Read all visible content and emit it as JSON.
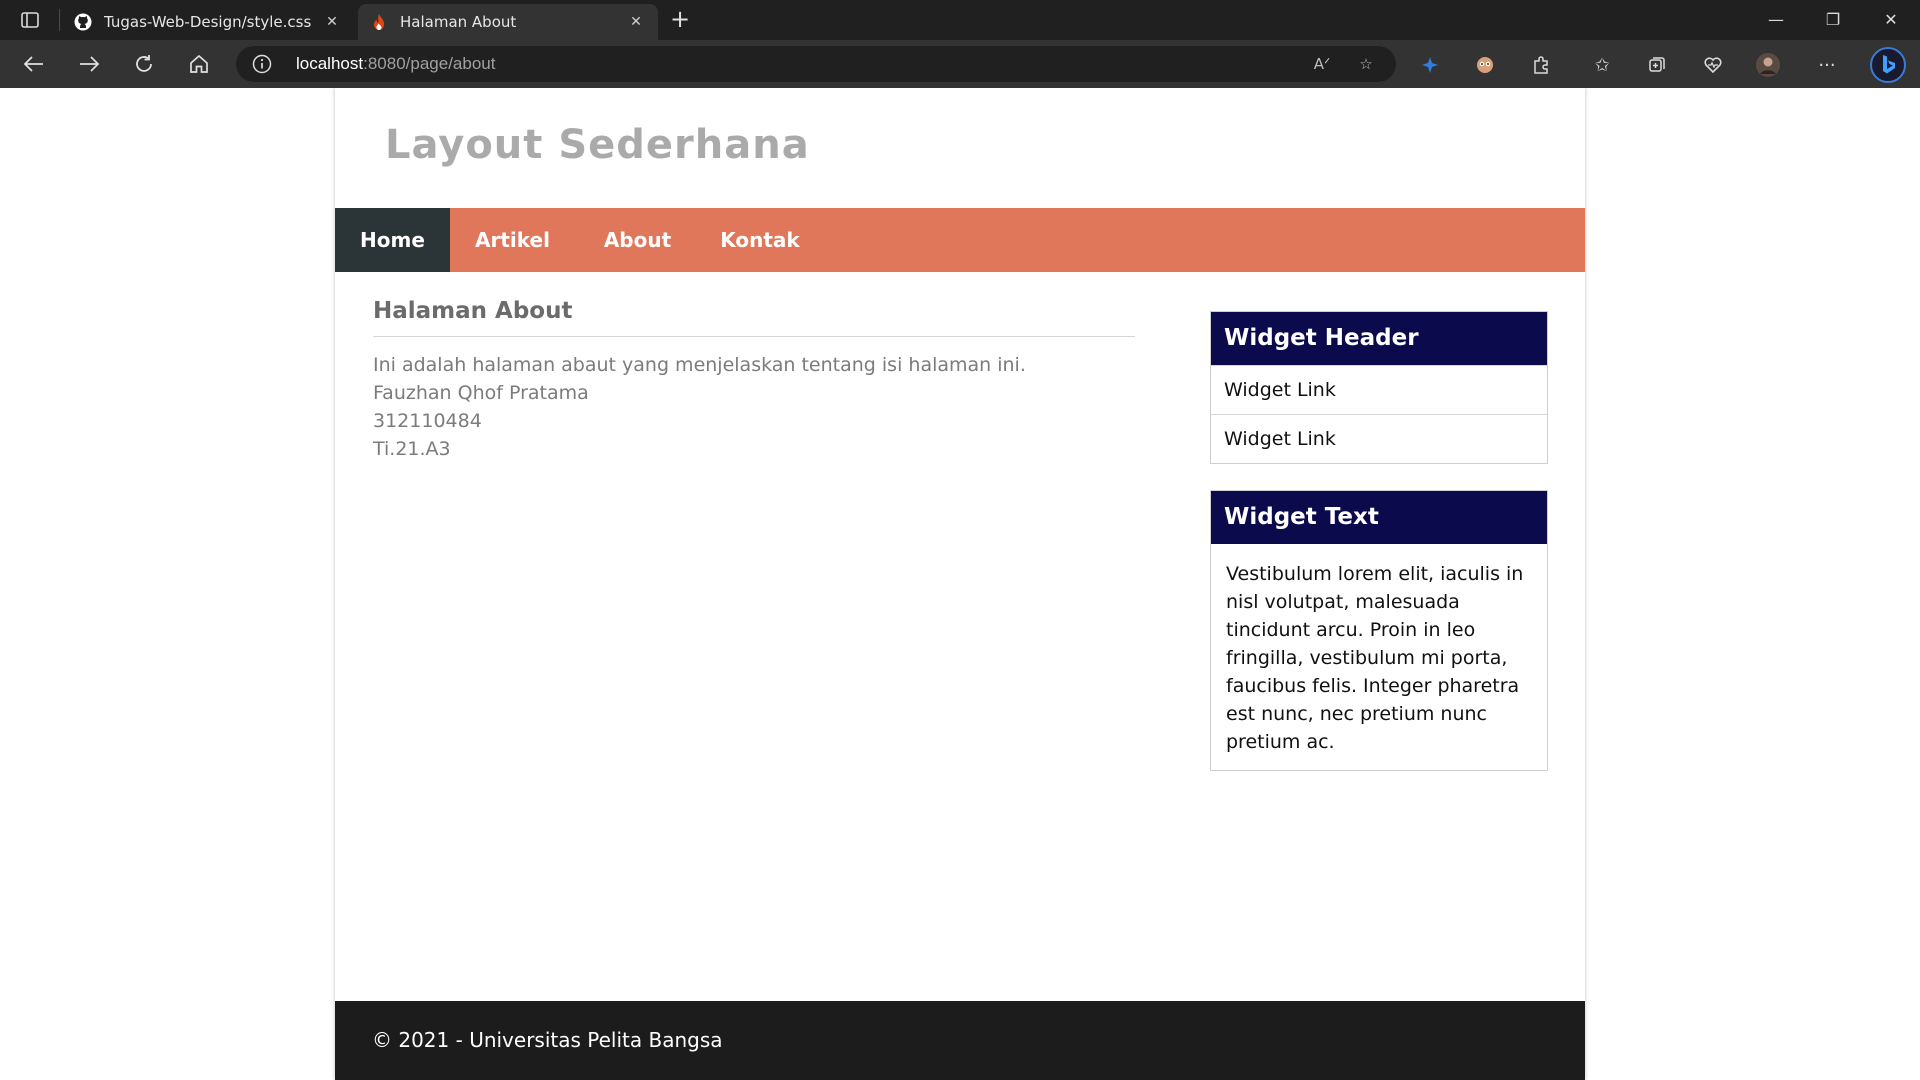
{
  "browser": {
    "tabs": [
      {
        "title": "Tugas-Web-Design/style.css at m",
        "icon": "github-icon",
        "active": false
      },
      {
        "title": "Halaman About",
        "icon": "codeigniter-icon",
        "active": true
      }
    ],
    "url_host": "localhost",
    "url_rest": ":8080/page/about"
  },
  "site": {
    "title": "Layout Sederhana",
    "nav": [
      "Home",
      "Artikel",
      "About",
      "Kontak"
    ],
    "active_nav": "Home",
    "colors": {
      "nav": "#e0775a",
      "nav_active": "#2b3537",
      "widget_header": "#0a0a4d",
      "footer": "#1c1c1c"
    }
  },
  "content": {
    "heading": "Halaman About",
    "lines": [
      "Ini adalah halaman abaut yang menjelaskan tentang isi halaman ini.",
      "Fauzhan Qhof Pratama",
      "312110484",
      "Ti.21.A3"
    ]
  },
  "sidebar": {
    "widget1": {
      "header": "Widget Header",
      "links": [
        "Widget Link",
        "Widget Link"
      ]
    },
    "widget2": {
      "header": "Widget Text",
      "text": "Vestibulum lorem elit, iaculis in nisl volutpat, malesuada tincidunt arcu. Proin in leo fringilla, vestibulum mi porta, faucibus felis. Integer pharetra est nunc, nec pretium nunc pretium ac."
    }
  },
  "footer": {
    "text": "© 2021 - Universitas Pelita Bangsa"
  }
}
